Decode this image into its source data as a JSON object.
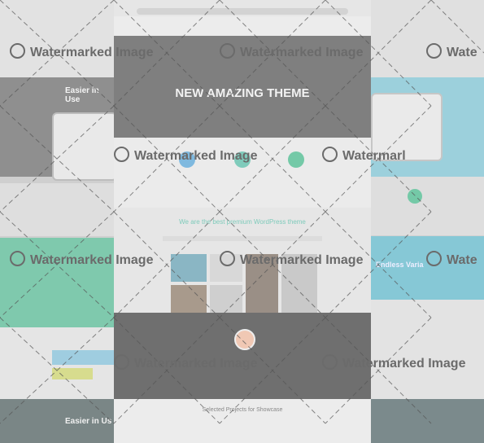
{
  "left_mock": {
    "hero_text": "Easier in Use",
    "bottom_text": "Easier in Us"
  },
  "center_mock": {
    "hero_title": "NEW AMAZING THEME",
    "tagline": "We are the best premium WordPress theme",
    "bottom_title": "Selected Projects for Showcase"
  },
  "right_mock": {
    "banner_text": "Endless Varia"
  },
  "watermark": {
    "text": "Watermarked Image",
    "partial_1": "Waterm",
    "partial_2": "Watermarl",
    "partial_3": "Wate"
  },
  "colors": {
    "teal": "#7fc9ad",
    "blue": "#86c8d6",
    "green": "#74c9a7"
  }
}
